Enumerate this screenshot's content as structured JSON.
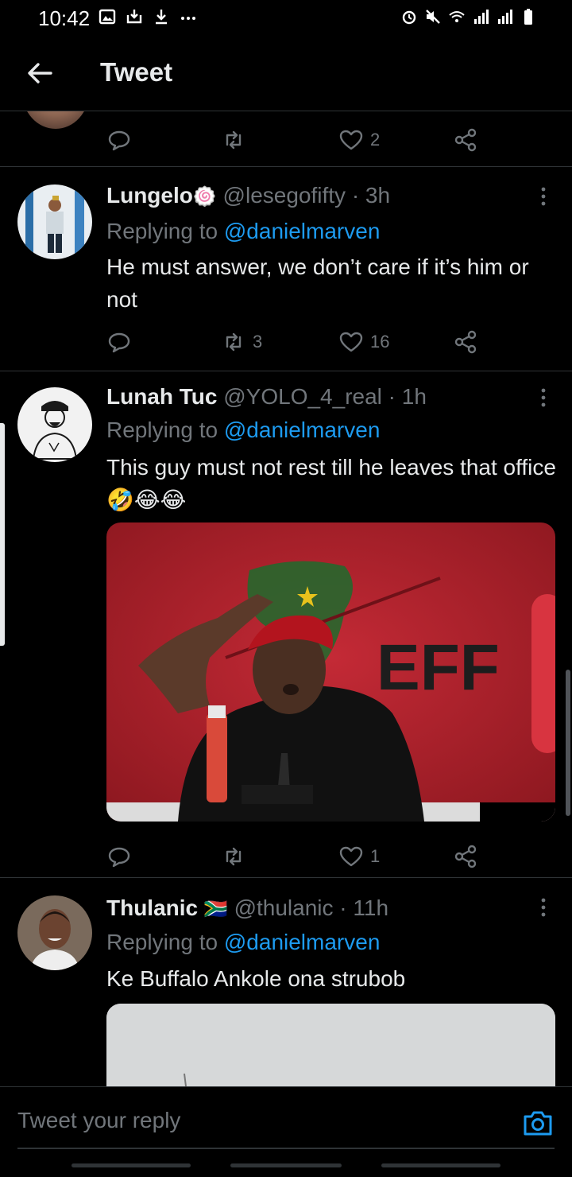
{
  "status_bar": {
    "time": "10:42",
    "left_icons": [
      "gallery-icon",
      "download-box-icon",
      "download-icon",
      "more-dots-icon"
    ],
    "right_icons": [
      "alarm-icon",
      "mute-icon",
      "wifi-icon",
      "signal-icon",
      "signal-icon",
      "battery-icon"
    ]
  },
  "header": {
    "title": "Tweet",
    "back_icon": "arrow-left-icon"
  },
  "top_actions": {
    "retweets": "",
    "likes": "2"
  },
  "tweets": [
    {
      "name": "Lungelo",
      "badge": "🍥",
      "handle": "@lesegofifty · 3h",
      "replying_prefix": "Replying to ",
      "replying_to": "@danielmarven",
      "text": "He must answer, we don’t care if it’s him or not",
      "retweets": "3",
      "likes": "16"
    },
    {
      "name": "Lunah Tuc",
      "badge": "",
      "handle": "@YOLO_4_real · 1h",
      "replying_prefix": "Replying to ",
      "replying_to": "@danielmarven",
      "text": "This guy must not rest till he leaves that office🤣😂😂",
      "retweets": "",
      "likes": "1",
      "media_text": "EFF"
    },
    {
      "name": "Thulanic",
      "badge": "🇿🇦",
      "handle": "@thulanic · 11h",
      "replying_prefix": "Replying to ",
      "replying_to": "@danielmarven",
      "text": "Ke Buffalo Ankole ona strubob"
    }
  ],
  "reply_bar": {
    "placeholder": "Tweet your reply",
    "camera_icon": "camera-icon"
  },
  "colors": {
    "background": "#000000",
    "text": "#e7e9ea",
    "secondary": "#71767b",
    "accent": "#1d9bf0",
    "divider": "#2f3336"
  }
}
